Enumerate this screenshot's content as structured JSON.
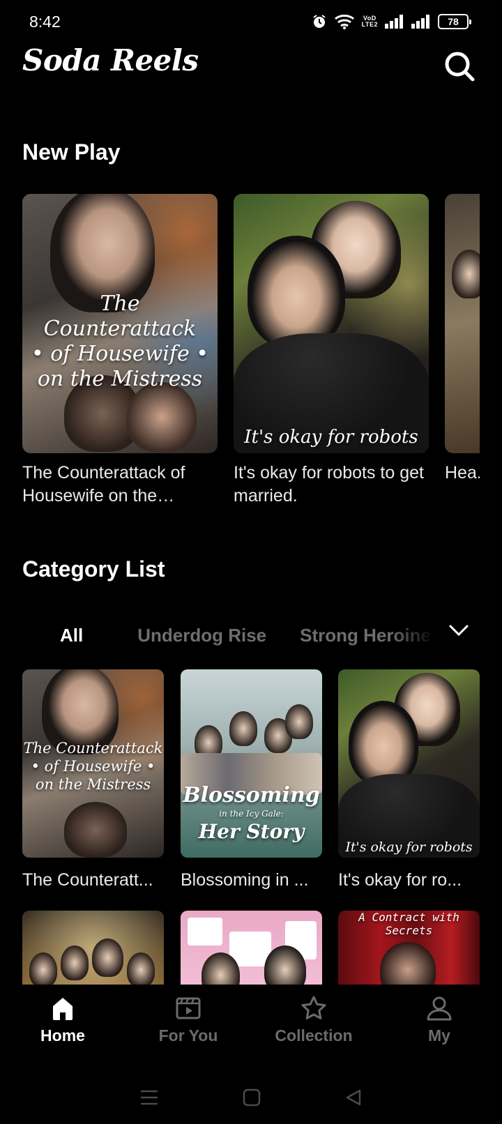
{
  "status_bar": {
    "time": "8:42",
    "network_label": "VoLTE",
    "volte_top": "VoD",
    "volte_bottom": "LTE2",
    "battery": "78"
  },
  "header": {
    "title": "Soda Reels"
  },
  "new_play": {
    "title": "New Play",
    "items": [
      {
        "title": "The Counterattack of Housewife on the Mistress",
        "poster_lines": [
          "The Counterattack",
          "• of Housewife •",
          "on the Mistress"
        ]
      },
      {
        "title": "It's okay for robots to get married.",
        "poster_caption": "It's okay for robots"
      },
      {
        "title": "Hea... Mor..."
      }
    ]
  },
  "category": {
    "title": "Category List",
    "tabs": [
      "All",
      "Underdog Rise",
      "Strong Heroine"
    ],
    "active_tab": "All",
    "grid": [
      {
        "title": "The Counteratt...",
        "poster_lines": [
          "The Counterattack",
          "• of Housewife •",
          "on the Mistress"
        ]
      },
      {
        "title": "Blossoming in ...",
        "poster_lines": [
          "Blossoming",
          "in the Icy Gale:",
          "Her Story"
        ]
      },
      {
        "title": "It's okay for ro...",
        "poster_caption": "It's okay for robots"
      },
      {
        "title": ""
      },
      {
        "title": ""
      },
      {
        "title": "",
        "poster_caption": "A Contract with Secrets"
      }
    ]
  },
  "bottom_nav": {
    "items": [
      {
        "label": "Home",
        "icon": "home-icon",
        "active": true
      },
      {
        "label": "For You",
        "icon": "play-clapper-icon",
        "active": false
      },
      {
        "label": "Collection",
        "icon": "star-icon",
        "active": false
      },
      {
        "label": "My",
        "icon": "user-icon",
        "active": false
      }
    ]
  },
  "colors": {
    "background": "#000000",
    "text": "#ffffff",
    "muted": "#6e6e6e"
  }
}
